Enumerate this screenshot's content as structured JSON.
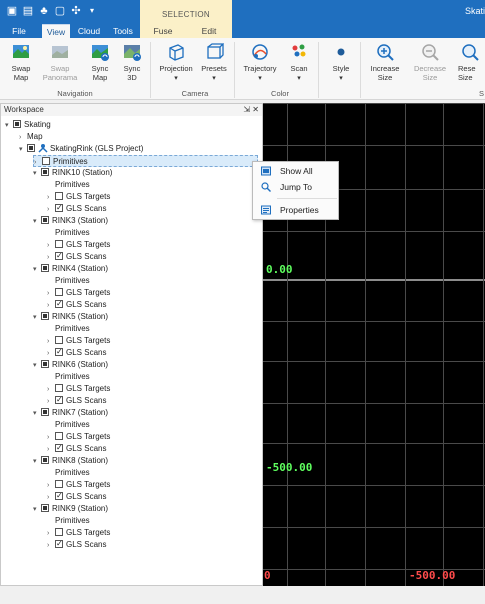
{
  "titlebar": {
    "app_title": "Skati",
    "context_group": "SELECTION",
    "qat_icons": [
      "save-icon",
      "open-icon",
      "tree-icon",
      "box-icon",
      "settings-icon",
      "dropdown-icon"
    ]
  },
  "tabs": [
    {
      "label": "File"
    },
    {
      "label": "View"
    },
    {
      "label": "Cloud"
    },
    {
      "label": "Tools"
    },
    {
      "label": "Fuse"
    },
    {
      "label": "Edit"
    }
  ],
  "ribbon": {
    "buttons": [
      {
        "label": "Swap\nMap",
        "enabled": true
      },
      {
        "label": "Swap\nPanorama",
        "enabled": false
      },
      {
        "label": "Sync\nMap",
        "enabled": true
      },
      {
        "label": "Sync\n3D",
        "enabled": true
      },
      {
        "label": "Projection",
        "enabled": true
      },
      {
        "label": "Presets",
        "enabled": true
      },
      {
        "label": "Trajectory",
        "enabled": true
      },
      {
        "label": "Scan",
        "enabled": true
      },
      {
        "label": "Style",
        "enabled": true
      },
      {
        "label": "Increase\nSize",
        "enabled": true
      },
      {
        "label": "Decrease\nSize",
        "enabled": false
      },
      {
        "label": "Rese\nSize",
        "enabled": true
      }
    ],
    "groups": [
      "Navigation",
      "Camera",
      "Color",
      "S"
    ]
  },
  "workspace": {
    "title": "Workspace",
    "controls": [
      "pin-icon",
      "close-icon"
    ],
    "tree": [
      {
        "label": "Skating",
        "level": 0,
        "arrow": "down",
        "check": "filled"
      },
      {
        "label": "Map",
        "level": 1,
        "arrow": "right",
        "check": "none"
      },
      {
        "label": "SkatingRink (GLS Project)",
        "level": 1,
        "arrow": "down",
        "check": "filled",
        "icon": "project-icon"
      },
      {
        "label": "Primitives",
        "level": 2,
        "arrow": "right",
        "check": "empty",
        "selected": true
      },
      {
        "label": "RINK10 (Station)",
        "level": 2,
        "arrow": "down",
        "check": "filled"
      },
      {
        "label": "Primitives",
        "level": 3,
        "arrow": "none",
        "check": "none"
      },
      {
        "label": "GLS Targets",
        "level": 3,
        "arrow": "right",
        "check": "empty"
      },
      {
        "label": "GLS Scans",
        "level": 3,
        "arrow": "right",
        "check": "checked"
      },
      {
        "label": "RINK3 (Station)",
        "level": 2,
        "arrow": "down",
        "check": "filled"
      },
      {
        "label": "Primitives",
        "level": 3,
        "arrow": "none",
        "check": "none"
      },
      {
        "label": "GLS Targets",
        "level": 3,
        "arrow": "right",
        "check": "empty"
      },
      {
        "label": "GLS Scans",
        "level": 3,
        "arrow": "right",
        "check": "checked"
      },
      {
        "label": "RINK4 (Station)",
        "level": 2,
        "arrow": "down",
        "check": "filled"
      },
      {
        "label": "Primitives",
        "level": 3,
        "arrow": "none",
        "check": "none"
      },
      {
        "label": "GLS Targets",
        "level": 3,
        "arrow": "right",
        "check": "empty"
      },
      {
        "label": "GLS Scans",
        "level": 3,
        "arrow": "right",
        "check": "checked"
      },
      {
        "label": "RINK5 (Station)",
        "level": 2,
        "arrow": "down",
        "check": "filled"
      },
      {
        "label": "Primitives",
        "level": 3,
        "arrow": "none",
        "check": "none"
      },
      {
        "label": "GLS Targets",
        "level": 3,
        "arrow": "right",
        "check": "empty"
      },
      {
        "label": "GLS Scans",
        "level": 3,
        "arrow": "right",
        "check": "checked"
      },
      {
        "label": "RINK6 (Station)",
        "level": 2,
        "arrow": "down",
        "check": "filled"
      },
      {
        "label": "Primitives",
        "level": 3,
        "arrow": "none",
        "check": "none"
      },
      {
        "label": "GLS Targets",
        "level": 3,
        "arrow": "right",
        "check": "empty"
      },
      {
        "label": "GLS Scans",
        "level": 3,
        "arrow": "right",
        "check": "checked"
      },
      {
        "label": "RINK7 (Station)",
        "level": 2,
        "arrow": "down",
        "check": "filled"
      },
      {
        "label": "Primitives",
        "level": 3,
        "arrow": "none",
        "check": "none"
      },
      {
        "label": "GLS Targets",
        "level": 3,
        "arrow": "right",
        "check": "empty"
      },
      {
        "label": "GLS Scans",
        "level": 3,
        "arrow": "right",
        "check": "checked"
      },
      {
        "label": "RINK8 (Station)",
        "level": 2,
        "arrow": "down",
        "check": "filled"
      },
      {
        "label": "Primitives",
        "level": 3,
        "arrow": "none",
        "check": "none"
      },
      {
        "label": "GLS Targets",
        "level": 3,
        "arrow": "right",
        "check": "empty"
      },
      {
        "label": "GLS Scans",
        "level": 3,
        "arrow": "right",
        "check": "checked"
      },
      {
        "label": "RINK9 (Station)",
        "level": 2,
        "arrow": "down",
        "check": "filled"
      },
      {
        "label": "Primitives",
        "level": 3,
        "arrow": "none",
        "check": "none"
      },
      {
        "label": "GLS Targets",
        "level": 3,
        "arrow": "right",
        "check": "empty"
      },
      {
        "label": "GLS Scans",
        "level": 3,
        "arrow": "right",
        "check": "checked"
      }
    ]
  },
  "context_menu": {
    "items": [
      {
        "label": "Show All",
        "icon": "show-all-icon"
      },
      {
        "label": "Jump To",
        "icon": "jump-to-icon"
      },
      {
        "label": "Properties",
        "icon": "properties-icon"
      }
    ]
  },
  "viewport": {
    "labels": [
      {
        "text": "0.00",
        "color": "green"
      },
      {
        "text": "-500.00",
        "color": "green"
      },
      {
        "text": "0",
        "color": "red"
      },
      {
        "text": "-500.00",
        "color": "red"
      }
    ]
  },
  "colors": {
    "titlebar": "#1f6fbf",
    "context_tab": "#fbf0c8",
    "viewport_bg": "#000000",
    "viewport_label_green": "#5fff5f",
    "viewport_label_red": "#ff4b4b"
  }
}
